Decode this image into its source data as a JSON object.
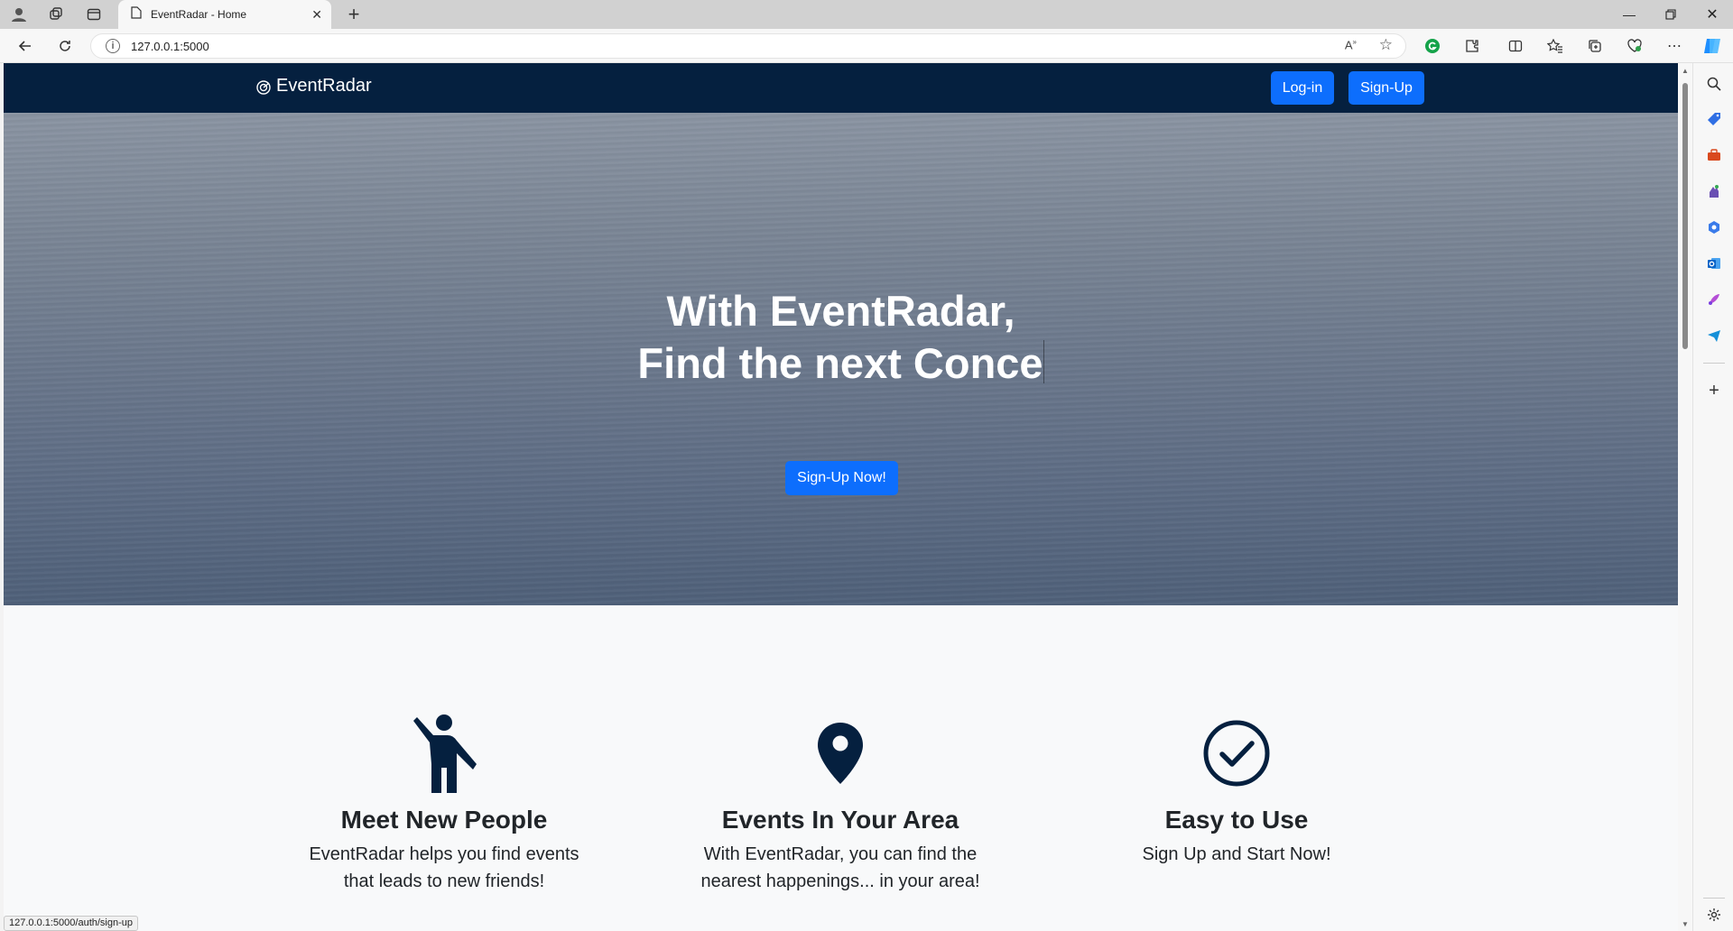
{
  "browser": {
    "tab_title": "EventRadar - Home",
    "url": "127.0.0.1:5000",
    "status_url": "127.0.0.1:5000/auth/sign-up"
  },
  "navbar": {
    "brand": "EventRadar",
    "login_label": "Log-in",
    "signup_label": "Sign-Up"
  },
  "hero": {
    "line1": "With EventRadar,",
    "line2": "Find the next Conce",
    "cta_label": "Sign-Up Now!"
  },
  "features": [
    {
      "icon": "person-waving-icon",
      "title": "Meet New People",
      "text_line1": "EventRadar helps you find events",
      "text_line2": "that leads to new friends!"
    },
    {
      "icon": "location-pin-icon",
      "title": "Events In Your Area",
      "text_line1": "With EventRadar, you can find the",
      "text_line2": "nearest happenings... in your area!"
    },
    {
      "icon": "check-circle-icon",
      "title": "Easy to Use",
      "text_line1": "Sign Up and Start Now!",
      "text_line2": ""
    }
  ],
  "colors": {
    "navbar": "#05203f",
    "primary_button": "#0d6efd",
    "icon_dark": "#05203f"
  }
}
